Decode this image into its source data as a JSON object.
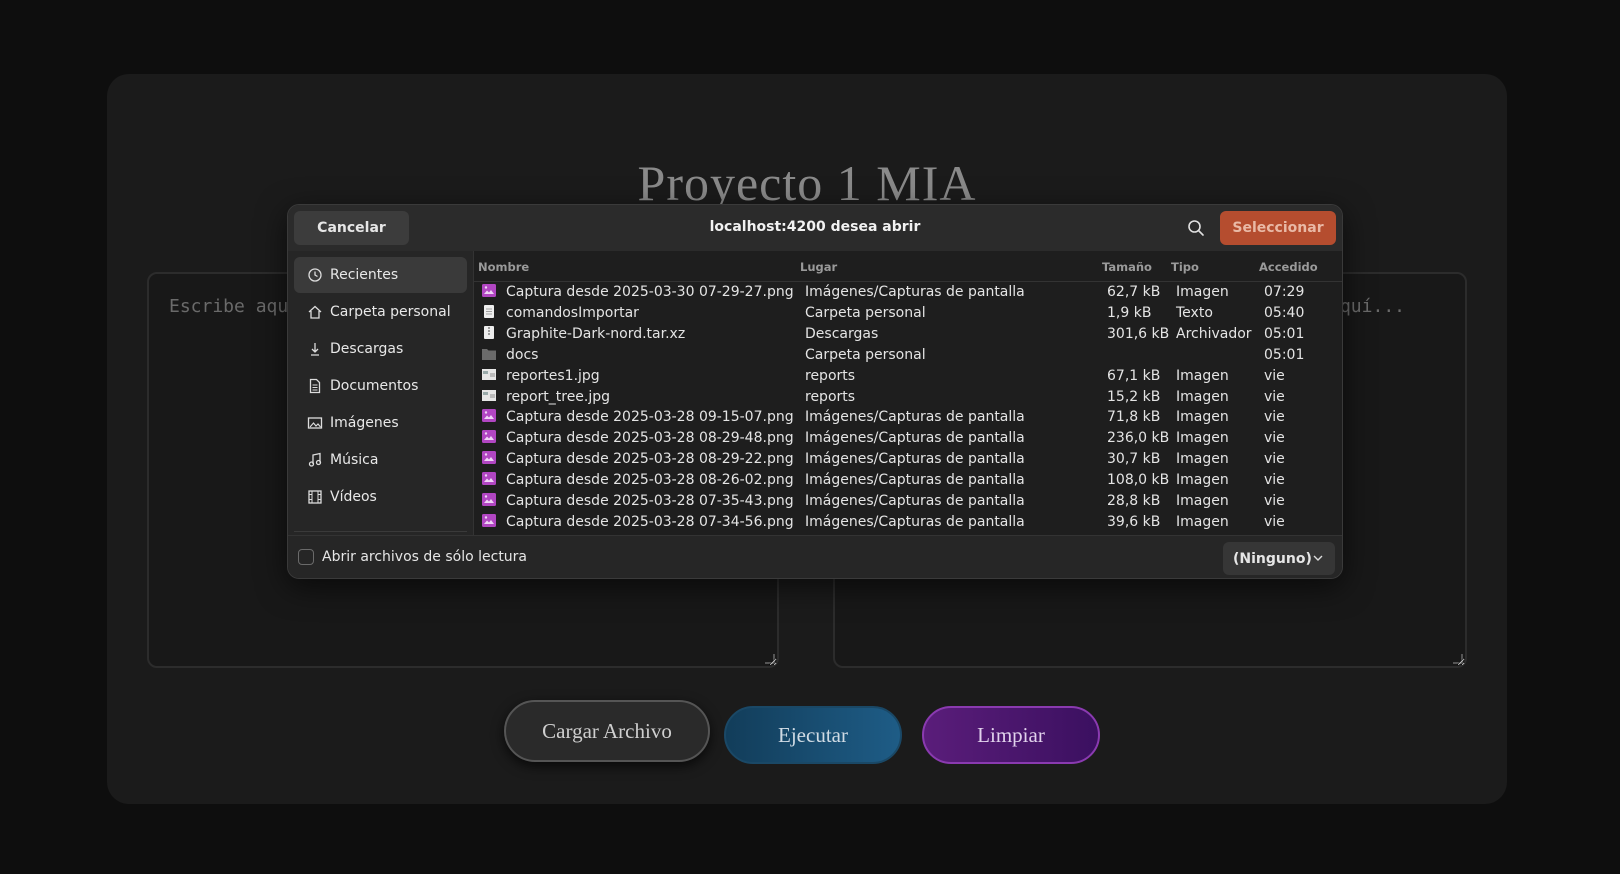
{
  "app": {
    "title": "Proyecto 1 MIA",
    "left_editor_placeholder": "Escribe aqu",
    "right_editor_placeholder": "quí...",
    "buttons": {
      "load": "Cargar Archivo",
      "run": "Ejecutar",
      "clear": "Limpiar"
    }
  },
  "dialog": {
    "title": "localhost:4200 desea abrir",
    "cancel": "Cancelar",
    "select": "Seleccionar",
    "sidebar": [
      {
        "label": "Recientes",
        "icon": "clock-icon",
        "active": true
      },
      {
        "label": "Carpeta personal",
        "icon": "home-icon"
      },
      {
        "label": "Descargas",
        "icon": "download-icon"
      },
      {
        "label": "Documentos",
        "icon": "document-icon"
      },
      {
        "label": "Imágenes",
        "icon": "image-icon"
      },
      {
        "label": "Música",
        "icon": "music-icon"
      },
      {
        "label": "Vídeos",
        "icon": "film-icon"
      }
    ],
    "columns": {
      "name": "Nombre",
      "location": "Lugar",
      "size": "Tamaño",
      "type": "Tipo",
      "accessed": "Accedido"
    },
    "files": [
      {
        "icon": "image-file-icon",
        "name": "Captura desde 2025-03-30 07-29-27.png",
        "location": "Imágenes/Capturas de pantalla",
        "size": "62,7 kB",
        "type": "Imagen",
        "accessed": "07:29"
      },
      {
        "icon": "text-file-icon",
        "name": "comandosImportar",
        "location": "Carpeta personal",
        "size": "1,9 kB",
        "type": "Texto",
        "accessed": "05:40"
      },
      {
        "icon": "archive-file-icon",
        "name": "Graphite-Dark-nord.tar.xz",
        "location": "Descargas",
        "size": "301,6 kB",
        "type": "Archivador",
        "accessed": "05:01"
      },
      {
        "icon": "folder-icon",
        "name": "docs",
        "location": "Carpeta personal",
        "size": "",
        "type": "",
        "accessed": "05:01"
      },
      {
        "icon": "thumbnail-icon",
        "name": "reportes1.jpg",
        "location": "reports",
        "size": "67,1 kB",
        "type": "Imagen",
        "accessed": "vie"
      },
      {
        "icon": "thumbnail-icon",
        "name": "report_tree.jpg",
        "location": "reports",
        "size": "15,2 kB",
        "type": "Imagen",
        "accessed": "vie"
      },
      {
        "icon": "image-file-icon",
        "name": "Captura desde 2025-03-28 09-15-07.png",
        "location": "Imágenes/Capturas de pantalla",
        "size": "71,8 kB",
        "type": "Imagen",
        "accessed": "vie"
      },
      {
        "icon": "image-file-icon",
        "name": "Captura desde 2025-03-28 08-29-48.png",
        "location": "Imágenes/Capturas de pantalla",
        "size": "236,0 kB",
        "type": "Imagen",
        "accessed": "vie"
      },
      {
        "icon": "image-file-icon",
        "name": "Captura desde 2025-03-28 08-29-22.png",
        "location": "Imágenes/Capturas de pantalla",
        "size": "30,7 kB",
        "type": "Imagen",
        "accessed": "vie"
      },
      {
        "icon": "image-file-icon",
        "name": "Captura desde 2025-03-28 08-26-02.png",
        "location": "Imágenes/Capturas de pantalla",
        "size": "108,0 kB",
        "type": "Imagen",
        "accessed": "vie"
      },
      {
        "icon": "image-file-icon",
        "name": "Captura desde 2025-03-28 07-35-43.png",
        "location": "Imágenes/Capturas de pantalla",
        "size": "28,8 kB",
        "type": "Imagen",
        "accessed": "vie"
      },
      {
        "icon": "image-file-icon",
        "name": "Captura desde 2025-03-28 07-34-56.png",
        "location": "Imágenes/Capturas de pantalla",
        "size": "39,6 kB",
        "type": "Imagen",
        "accessed": "vie"
      }
    ],
    "readonly_label": "Abrir archivos de sólo lectura",
    "filter": "(Ninguno)"
  },
  "colors": {
    "accent_select": "#b54d2f",
    "run_button": "#1e5c86",
    "clear_button": "#5a1d7a",
    "page_bg": "#0e0e0e",
    "card_bg": "#1b1b1b"
  }
}
